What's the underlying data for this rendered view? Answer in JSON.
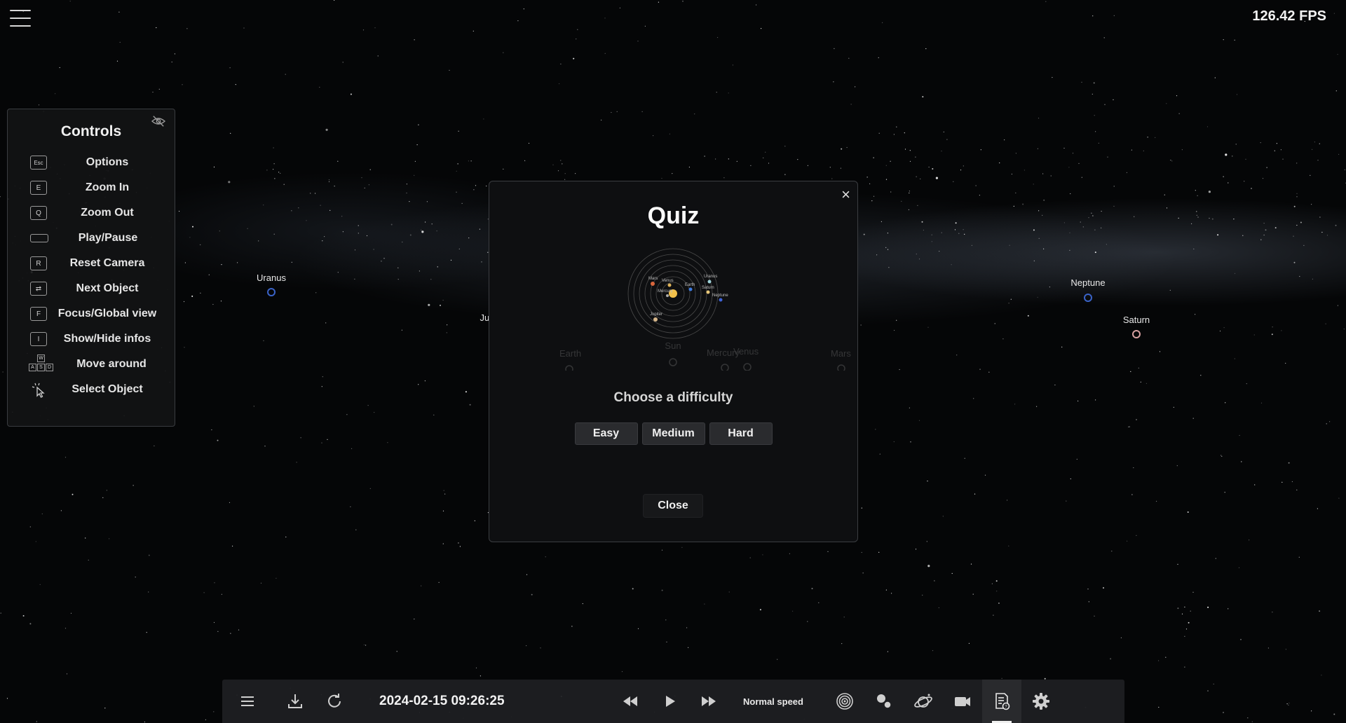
{
  "fps": "126.42 FPS",
  "controls": {
    "title": "Controls",
    "items": [
      {
        "key": "Esc",
        "label": "Options",
        "icon": "esc-key-icon"
      },
      {
        "key": "E",
        "label": "Zoom In",
        "icon": "e-key-icon"
      },
      {
        "key": "Q",
        "label": "Zoom Out",
        "icon": "q-key-icon"
      },
      {
        "key": "",
        "label": "Play/Pause",
        "icon": "spacebar-key-icon"
      },
      {
        "key": "R",
        "label": "Reset Camera",
        "icon": "r-key-icon"
      },
      {
        "key": "⇄",
        "label": "Next Object",
        "icon": "tab-key-icon"
      },
      {
        "key": "F",
        "label": "Focus/Global view",
        "icon": "f-key-icon"
      },
      {
        "key": "I",
        "label": "Show/Hide infos",
        "icon": "i-key-icon"
      },
      {
        "key": "WASD",
        "label": "Move around",
        "icon": "wasd-keys-icon"
      },
      {
        "key": "",
        "label": "Select Object",
        "icon": "mouse-click-icon"
      }
    ],
    "wasd": [
      "W",
      "A",
      "S",
      "D"
    ]
  },
  "planets": {
    "uranus": {
      "name": "Uranus",
      "color": "#3a63c8"
    },
    "jupiter": {
      "name": "Jupiter",
      "color": "#a88a6a"
    },
    "neptune": {
      "name": "Neptune",
      "color": "#3a63c8"
    },
    "saturn": {
      "name": "Saturn",
      "color": "#d8a0a0"
    },
    "earth": {
      "name": "Earth",
      "color": "#666"
    },
    "sun": {
      "name": "Sun",
      "color": "#666"
    },
    "mercury": {
      "name": "Mercury",
      "color": "#666"
    },
    "venus": {
      "name": "Venus",
      "color": "#666"
    },
    "mars": {
      "name": "Mars",
      "color": "#666"
    }
  },
  "quiz": {
    "title": "Quiz",
    "close_x": "×",
    "choose_label": "Choose a difficulty",
    "difficulties": [
      "Easy",
      "Medium",
      "Hard"
    ],
    "close_label": "Close",
    "preview_labels": [
      "Mars",
      "Venus",
      "Earth",
      "Uranus",
      "Saturn",
      "Mercury",
      "Neptune",
      "Jupiter"
    ]
  },
  "toolbar": {
    "datetime": "2024-02-15 09:26:25",
    "speed": "Normal speed",
    "icons": [
      "menu-icon",
      "download-icon",
      "refresh-icon",
      "rewind-icon",
      "play-icon",
      "fast-forward-icon",
      "orbits-icon",
      "planets-icon",
      "satellite-icon",
      "camera-icon",
      "quiz-icon",
      "settings-icon"
    ],
    "active_icon": "quiz-icon"
  }
}
